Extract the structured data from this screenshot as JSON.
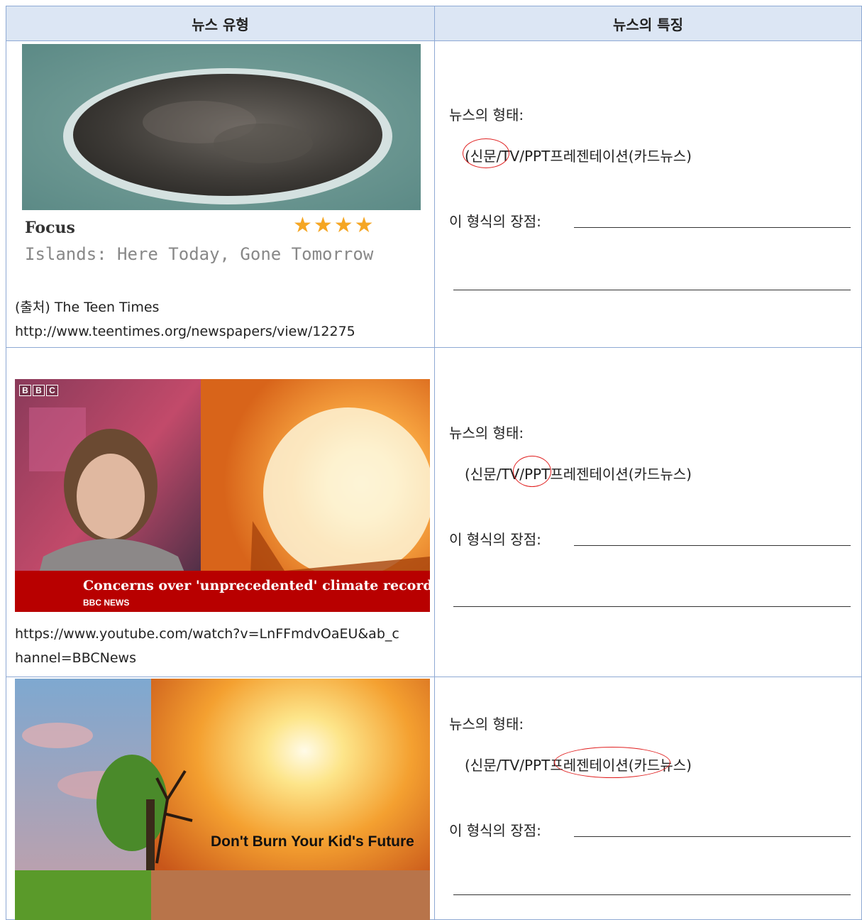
{
  "header": {
    "col1": "뉴스 유형",
    "col2": "뉴스의 특징"
  },
  "rows": [
    {
      "thumb": {
        "title": "Focus",
        "stars": "★★★★",
        "subtitle": "Islands: Here Today, Gone Tomorrow"
      },
      "source_line1": "(출처) The Teen Times",
      "source_line2": "http://www.teentimes.org/newspapers/view/12275",
      "form_label": "뉴스의 형태:",
      "options": "(신문/TV/PPT프레젠테이션(카드뉴스)",
      "advantage_label": "이 형식의 장점:"
    },
    {
      "thumb": {
        "logo": [
          "B",
          "B",
          "C"
        ],
        "headline": "Concerns over 'unprecedented' climate records",
        "brand": "BBC NEWS"
      },
      "source_line1": "https://www.youtube.com/watch?v=LnFFmdvOaEU&ab_c",
      "source_line2": "hannel=BBCNews",
      "form_label": "뉴스의 형태:",
      "options": "(신문/TV/PPT프레젠테이션(카드뉴스)",
      "advantage_label": "이 형식의 장점:"
    },
    {
      "thumb": {
        "caption": "Don't Burn Your Kid's Future"
      },
      "form_label": "뉴스의 형태:",
      "options": "(신문/TV/PPT프레젠테이션(카드뉴스)",
      "advantage_label": "이 형식의 장점:"
    }
  ],
  "colors": {
    "header_bg": "#dce6f4",
    "border": "#8ea9d4",
    "circle": "#e02020",
    "bbc_red": "#b80000"
  }
}
